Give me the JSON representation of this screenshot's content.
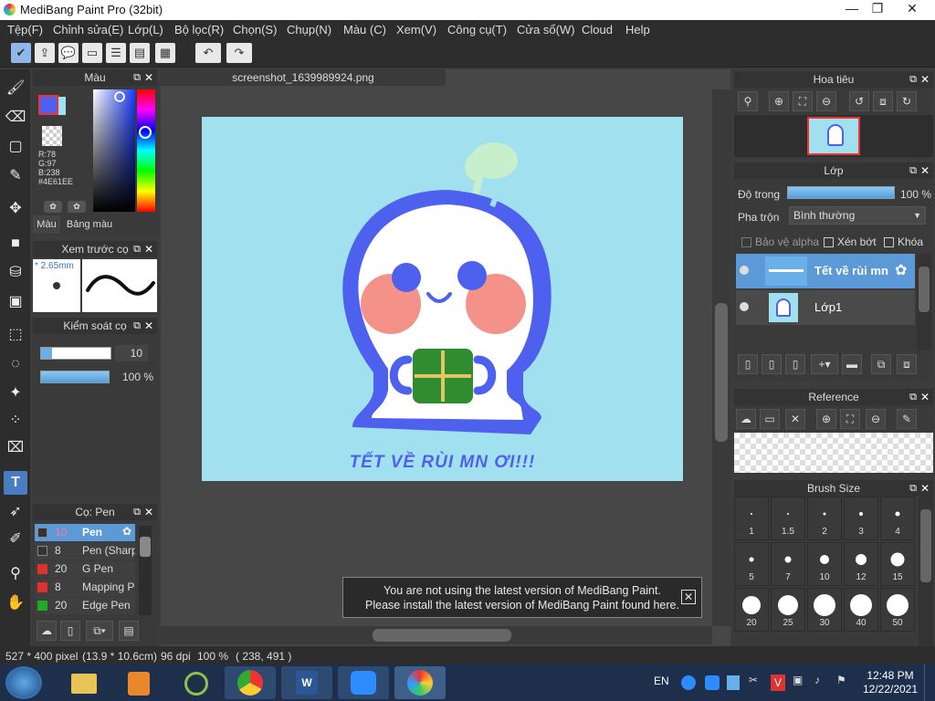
{
  "window": {
    "title": "MediBang Paint Pro (32bit)",
    "minimize": "—",
    "restore": "❐",
    "close": "✕"
  },
  "menu": [
    "Tệp(F)",
    "Chỉnh sửa(E)",
    "Lớp(L)",
    "Bộ lọc(R)",
    "Chọn(S)",
    "Chụp(N)",
    "Màu (C)",
    "Xem(V)",
    "Công cụ(T)",
    "Cửa sổ(W)",
    "Cloud",
    "Help"
  ],
  "document": {
    "tab": "screenshot_1639989924.png",
    "art_text": "TẾT VỀ RÙI MN ƠI!!!"
  },
  "color_panel": {
    "title": "Màu",
    "r": "R:78",
    "g": "G:97",
    "b": "B:238",
    "hex": "#4E61EE",
    "tab1": "Màu",
    "tab2": "Bảng màu",
    "fg": "#4e61ee",
    "bg": "#a1e0ef"
  },
  "brush_preview": {
    "title": "Xem trước cọ",
    "size": "* 2.65mm"
  },
  "brush_control": {
    "title": "Kiểm soát cọ",
    "size_value": "10",
    "opacity_value": "100 %"
  },
  "brush_list": {
    "title": "Cọ: Pen",
    "items": [
      {
        "size": "10",
        "name": "Pen",
        "color": "#333333",
        "selected": true
      },
      {
        "size": "8",
        "name": "Pen (Sharp)",
        "color": "#333333",
        "selected": false
      },
      {
        "size": "20",
        "name": "G Pen",
        "color": "#e03030",
        "selected": false
      },
      {
        "size": "8",
        "name": "Mapping Pen",
        "color": "#e03030",
        "selected": false
      },
      {
        "size": "20",
        "name": "Edge Pen",
        "color": "#22aa22",
        "selected": false
      }
    ]
  },
  "navigator": {
    "title": "Hoa tiêu"
  },
  "layers": {
    "title": "Lớp",
    "opacity_label": "Độ trong",
    "opacity_value": "100 %",
    "blend_label": "Pha trộn",
    "blend_value": "Bình thường",
    "protect_alpha": "Bảo vệ alpha",
    "clip": "Xén bớt",
    "lock": "Khóa",
    "items": [
      {
        "name": "Tết về rùi mn",
        "selected": true
      },
      {
        "name": "Lớp1",
        "selected": false
      }
    ]
  },
  "reference": {
    "title": "Reference"
  },
  "brush_size": {
    "title": "Brush Size",
    "sizes": [
      "1",
      "1.5",
      "2",
      "3",
      "4",
      "5",
      "7",
      "10",
      "12",
      "15",
      "20",
      "25",
      "30",
      "40",
      "50"
    ]
  },
  "notification": {
    "line1": "You are not using the latest version of MediBang Paint.",
    "line2": "Please install the latest version of MediBang Paint found here."
  },
  "status": {
    "size": "527 * 400 pixel",
    "cm": "(13.9 * 10.6cm)",
    "dpi": "96 dpi",
    "zoom": "100 %",
    "coords": "( 238, 491 )"
  },
  "taskbar": {
    "lang": "EN",
    "time": "12:48 PM",
    "date": "12/22/2021"
  }
}
